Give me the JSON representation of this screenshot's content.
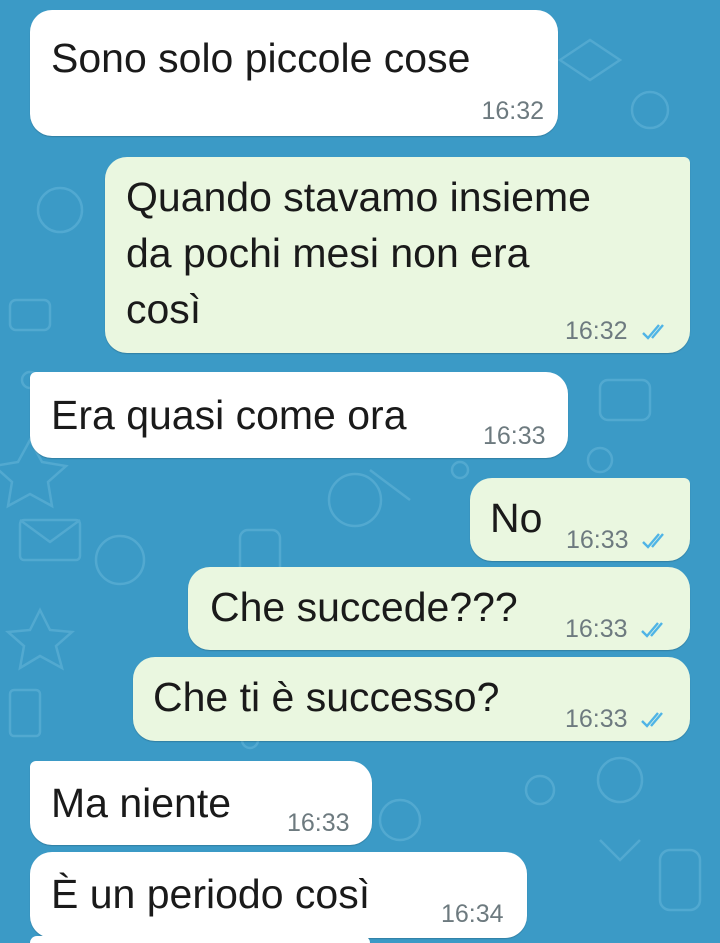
{
  "colors": {
    "wallpaper": "#3b9ac6",
    "incoming_bubble": "#ffffff",
    "outgoing_bubble": "#eaf7e0",
    "read_ticks": "#4fb4e6",
    "timestamp": "#6d7a7f"
  },
  "messages": [
    {
      "direction": "incoming",
      "text": "Sono solo piccole cose",
      "time": "16:32",
      "status_icon": "none"
    },
    {
      "direction": "outgoing",
      "text": "Quando stavamo insieme\nda pochi mesi non era\ncosì",
      "time": "16:32",
      "status_icon": "double-check-read-icon"
    },
    {
      "direction": "incoming",
      "text": "Era quasi come ora",
      "time": "16:33",
      "status_icon": "none"
    },
    {
      "direction": "outgoing",
      "text": "No",
      "time": "16:33",
      "status_icon": "double-check-read-icon"
    },
    {
      "direction": "outgoing",
      "text": "Che succede???",
      "time": "16:33",
      "status_icon": "double-check-read-icon"
    },
    {
      "direction": "outgoing",
      "text": "Che ti è successo?",
      "time": "16:33",
      "status_icon": "double-check-read-icon"
    },
    {
      "direction": "incoming",
      "text": "Ma niente",
      "time": "16:33",
      "status_icon": "none"
    },
    {
      "direction": "incoming",
      "text": "È un periodo così",
      "time": "16:34",
      "status_icon": "none"
    }
  ]
}
